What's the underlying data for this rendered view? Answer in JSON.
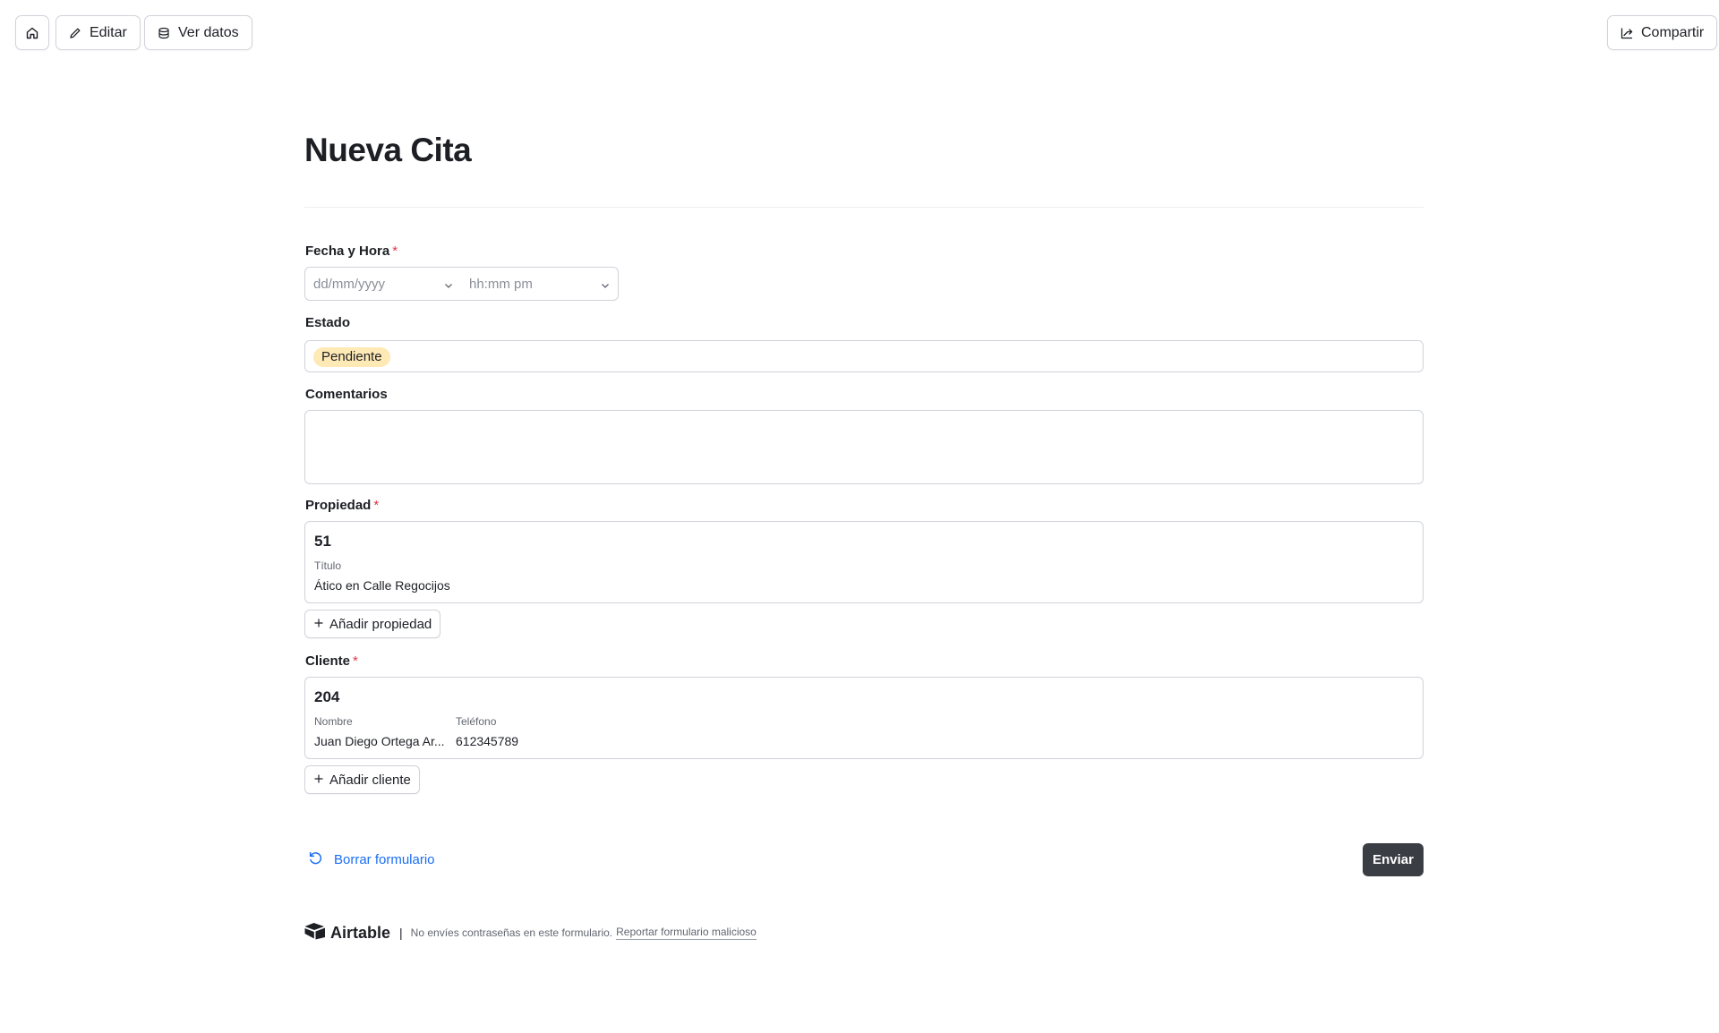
{
  "toolbar": {
    "home_icon": "home-icon",
    "edit_label": "Editar",
    "view_data_label": "Ver datos",
    "share_label": "Compartir"
  },
  "form": {
    "title": "Nueva Cita",
    "fields": {
      "datetime": {
        "label": "Fecha y Hora",
        "required": "*",
        "date_placeholder": "dd/mm/yyyy",
        "time_placeholder": "hh:mm pm"
      },
      "status": {
        "label": "Estado",
        "value": "Pendiente",
        "pill_color": "#ffeab6"
      },
      "comments": {
        "label": "Comentarios",
        "value": ""
      },
      "property": {
        "label": "Propiedad",
        "required": "*",
        "record": {
          "id": "51",
          "columns": [
            {
              "header": "Título",
              "value": "Ático en Calle Regocijos"
            }
          ]
        },
        "add_label": "Añadir propiedad"
      },
      "client": {
        "label": "Cliente",
        "required": "*",
        "record": {
          "id": "204",
          "columns": [
            {
              "header": "Nombre",
              "value": "Juan Diego Ortega Ar..."
            },
            {
              "header": "Teléfono",
              "value": "612345789"
            }
          ]
        },
        "add_label": "Añadir cliente"
      }
    },
    "clear_label": "Borrar formulario",
    "submit_label": "Enviar"
  },
  "footer": {
    "brand": "Airtable",
    "separator": "|",
    "note": "No envíes contraseñas en este formulario.",
    "report_link": "Reportar formulario malicioso"
  },
  "colors": {
    "accent_link": "#1b6ef3",
    "required": "#dc3545",
    "submit_bg": "#3b3d44"
  }
}
